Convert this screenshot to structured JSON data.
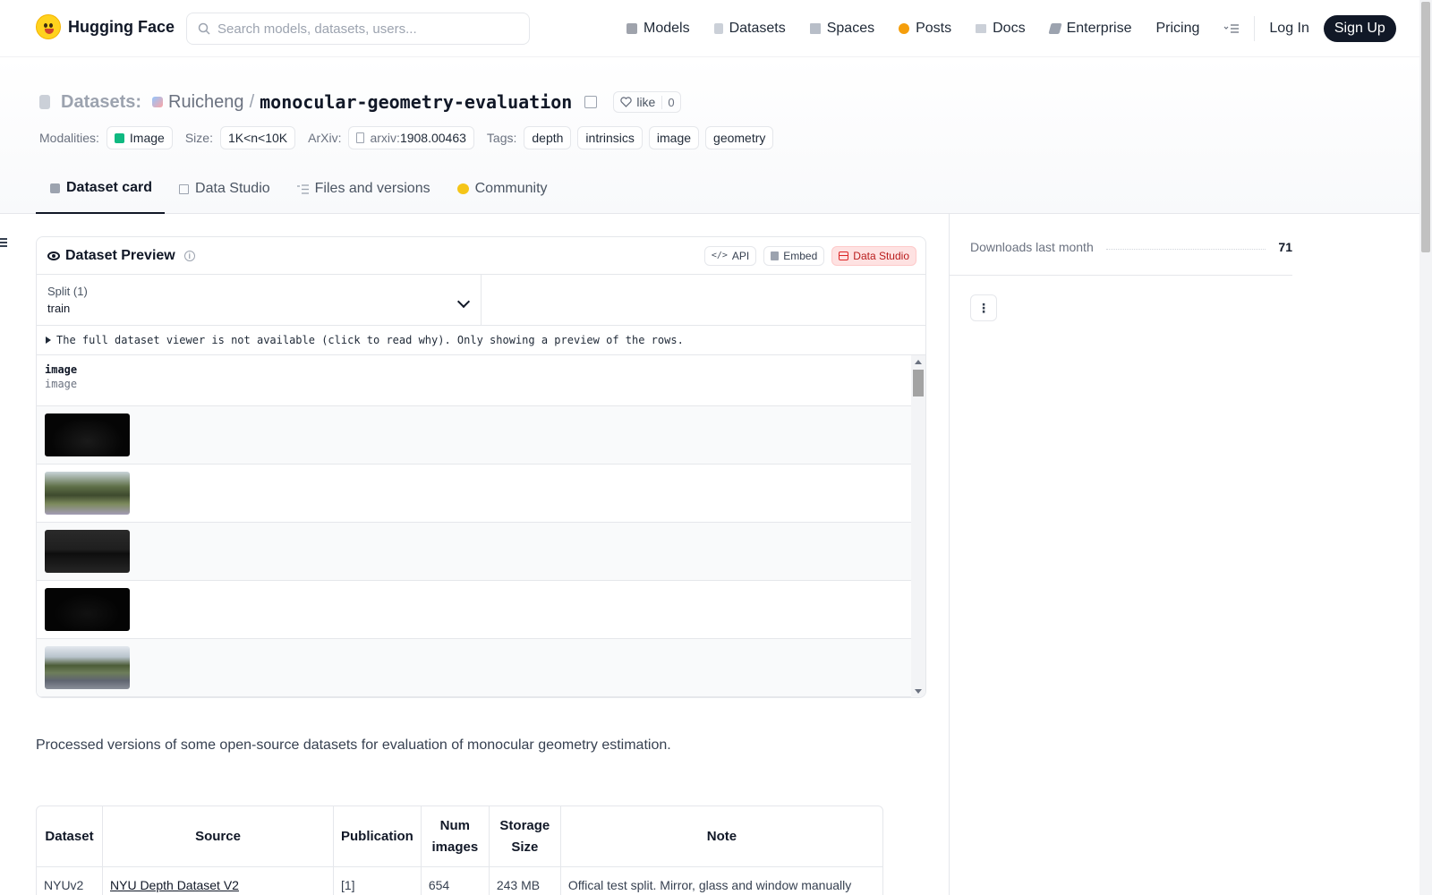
{
  "nav": {
    "brand": "Hugging Face",
    "search_placeholder": "Search models, datasets, users...",
    "items": [
      {
        "label": "Models",
        "icon": "cube-icon",
        "color": "#4b5563"
      },
      {
        "label": "Datasets",
        "icon": "database-icon",
        "color": "#9ca3af"
      },
      {
        "label": "Spaces",
        "icon": "spaces-icon",
        "color": "#6b7280"
      },
      {
        "label": "Posts",
        "icon": "posts-icon",
        "color": "#f59e0b"
      },
      {
        "label": "Docs",
        "icon": "book-icon",
        "color": "#6b7280"
      },
      {
        "label": "Enterprise",
        "icon": "enterprise-icon",
        "color": "#6b7280"
      },
      {
        "label": "Pricing",
        "icon": "",
        "color": ""
      }
    ],
    "login": "Log In",
    "signup": "Sign Up"
  },
  "header": {
    "section": "Datasets:",
    "owner": "Ruicheng",
    "separator": "/",
    "repo": "monocular-geometry-evaluation",
    "like_label": "like",
    "like_count": "0",
    "modalities_label": "Modalities:",
    "modality": "Image",
    "size_label": "Size:",
    "size": "1K<n<10K",
    "arxiv_label": "ArXiv:",
    "arxiv_prefix": "arxiv:",
    "arxiv_id": "1908.00463",
    "tags_label": "Tags:",
    "tags": [
      "depth",
      "intrinsics",
      "image",
      "geometry"
    ]
  },
  "tabs": [
    {
      "label": "Dataset card",
      "icon": "cube-icon",
      "active": true
    },
    {
      "label": "Data Studio",
      "icon": "table-icon",
      "active": false
    },
    {
      "label": "Files and versions",
      "icon": "files-icon",
      "active": false
    },
    {
      "label": "Community",
      "icon": "community-icon",
      "active": false
    }
  ],
  "preview": {
    "title": "Dataset Preview",
    "api": "API",
    "embed": "Embed",
    "studio": "Data Studio",
    "split_label": "Split (1)",
    "split_value": "train",
    "notice": "The full dataset viewer is not available (click to read why). Only showing a preview of the rows.",
    "column_name": "image",
    "column_type": "image",
    "thumbnails": [
      {
        "kind": "dark-depth",
        "color": "#050505"
      },
      {
        "kind": "park-trees",
        "color": "#5a6b45"
      },
      {
        "kind": "dark-street",
        "color": "#1f1f1f"
      },
      {
        "kind": "dark-depth",
        "color": "#040404"
      },
      {
        "kind": "road-scene",
        "color": "#6d7d5a"
      }
    ]
  },
  "description": "Processed versions of some open-source datasets for evaluation of monocular geometry estimation.",
  "data_table": {
    "headers": [
      "Dataset",
      "Source",
      "Publication",
      "Num images",
      "Storage Size",
      "Note"
    ],
    "rows": [
      [
        "NYUv2",
        "NYU Depth Dataset V2",
        "[1]",
        "654",
        "243 MB",
        "Offical test split. Mirror, glass and window manually"
      ]
    ]
  },
  "sidebar": {
    "downloads_label": "Downloads last month",
    "downloads_count": "71"
  }
}
